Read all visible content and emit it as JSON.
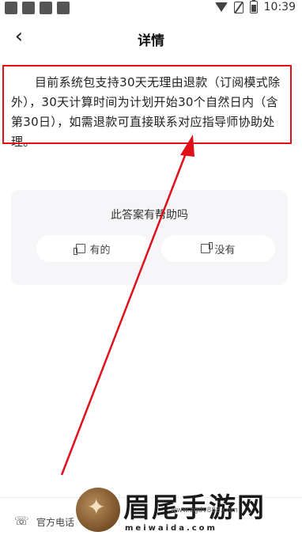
{
  "status_bar": {
    "time": "10:39",
    "icons": [
      "app-icon",
      "app-icon",
      "app-icon",
      "app-icon",
      "wifi-icon",
      "no-sim-icon",
      "battery-icon"
    ]
  },
  "header": {
    "title": "详情",
    "back_icon": "chevron-left-icon"
  },
  "answer": {
    "text": "目前系统包支持30天无理由退款（订阅模式除外），30天计算时间为计划开始30个自然日内（含第30日），如需退款可直接联系对应指导师协助处理。"
  },
  "feedback": {
    "question": "此答案有帮助吗",
    "yes_label": "有的",
    "no_label": "没有"
  },
  "footer": {
    "phone_label": "官方电话"
  },
  "watermark": {
    "title": "眉尾手游网",
    "sub": "www.zgdv888.com",
    "url": "meiwaida.com"
  },
  "colors": {
    "highlight": "#e0101a",
    "card_bg": "#f6f6f8"
  }
}
